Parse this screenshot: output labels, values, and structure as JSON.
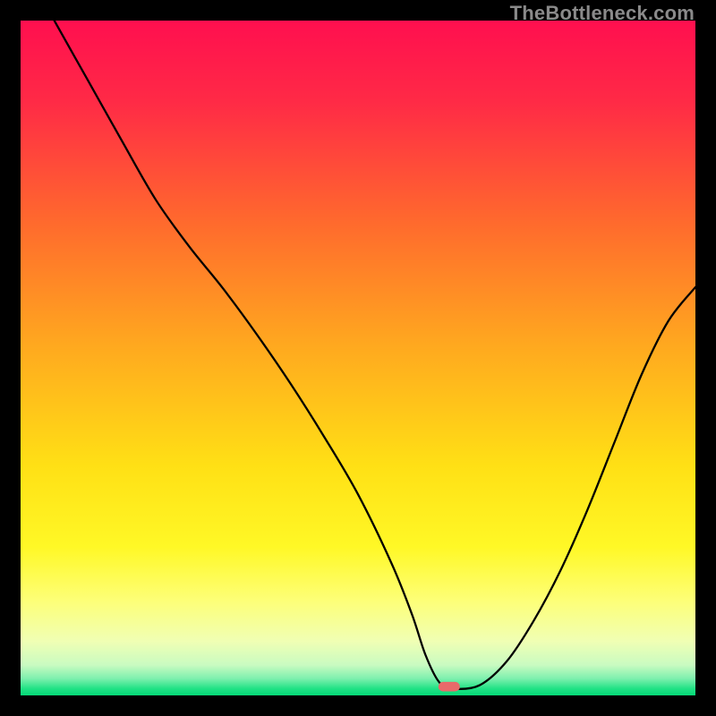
{
  "watermark": "TheBottleneck.com",
  "chart_data": {
    "type": "line",
    "title": "",
    "xlabel": "",
    "ylabel": "",
    "xlim": [
      0,
      100
    ],
    "ylim": [
      0,
      100
    ],
    "axes_visible": false,
    "grid": false,
    "legend": false,
    "background": {
      "description": "vertical gradient red-orange-yellow-green with thin green band at bottom",
      "stops": [
        {
          "offset": 0.0,
          "color": "#ff0f4f"
        },
        {
          "offset": 0.12,
          "color": "#ff2a46"
        },
        {
          "offset": 0.3,
          "color": "#ff6a2d"
        },
        {
          "offset": 0.48,
          "color": "#ffa81f"
        },
        {
          "offset": 0.66,
          "color": "#ffe015"
        },
        {
          "offset": 0.78,
          "color": "#fff826"
        },
        {
          "offset": 0.86,
          "color": "#fdff78"
        },
        {
          "offset": 0.92,
          "color": "#f0ffb4"
        },
        {
          "offset": 0.955,
          "color": "#c9fbc1"
        },
        {
          "offset": 0.975,
          "color": "#7ef0ae"
        },
        {
          "offset": 0.99,
          "color": "#20e285"
        },
        {
          "offset": 1.0,
          "color": "#05d977"
        }
      ]
    },
    "series": [
      {
        "name": "bottleneck-curve",
        "color": "#000000",
        "stroke_width": 2.3,
        "x": [
          5,
          10,
          15,
          20,
          25,
          30,
          35,
          40,
          45,
          50,
          55,
          58,
          60,
          62,
          64,
          68,
          72,
          76,
          80,
          84,
          88,
          92,
          96,
          100
        ],
        "y": [
          100,
          91.1,
          82.2,
          73.5,
          66.5,
          60.3,
          53.5,
          46.2,
          38.3,
          29.8,
          19.5,
          12.0,
          6.0,
          2.0,
          1.0,
          1.5,
          5.0,
          11.0,
          18.5,
          27.5,
          37.5,
          47.5,
          55.5,
          60.5
        ]
      }
    ],
    "marker": {
      "name": "optimal-point",
      "x": 63.5,
      "y": 1.3,
      "color": "#e86a6a",
      "shape": "rounded-pill",
      "width_pct": 3.2,
      "height_pct": 1.4
    }
  }
}
